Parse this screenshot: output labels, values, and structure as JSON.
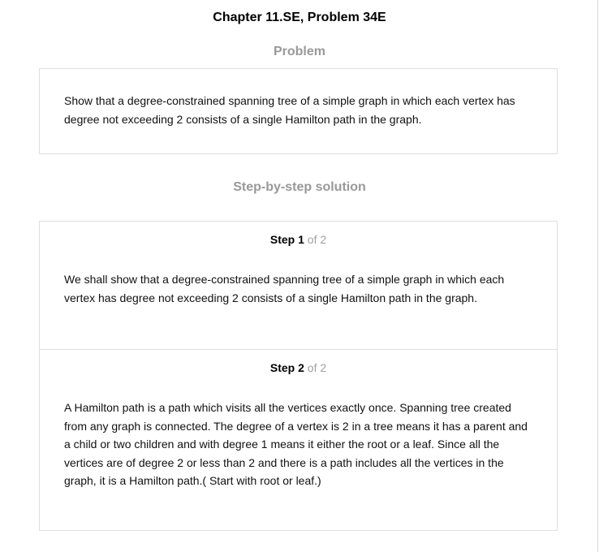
{
  "header": {
    "chapter_title": "Chapter 11.SE, Problem 34E"
  },
  "problem": {
    "heading": "Problem",
    "text": "Show that a degree-constrained spanning tree of a simple graph in which each vertex has degree not exceeding 2 consists of a single Hamilton path in the graph."
  },
  "solution": {
    "heading": "Step-by-step solution",
    "steps": [
      {
        "word": "Step",
        "number": "1",
        "of_total": "of 2",
        "text": "We shall show that a degree-constrained spanning tree of a simple graph in which each vertex has degree not exceeding 2 consists of a single Hamilton path in the graph."
      },
      {
        "word": "Step",
        "number": "2",
        "of_total": "of 2",
        "text": "A Hamilton path is a path which visits all the vertices exactly once. Spanning tree created from any graph is connected. The degree of a vertex is 2 in a tree means it has a parent and a child or two children and with degree 1 means it either the root or a leaf. Since all the vertices are of degree 2 or less than 2 and there is a path includes all the vertices in the graph, it is a Hamilton path.( Start with root or leaf.)"
      }
    ]
  }
}
